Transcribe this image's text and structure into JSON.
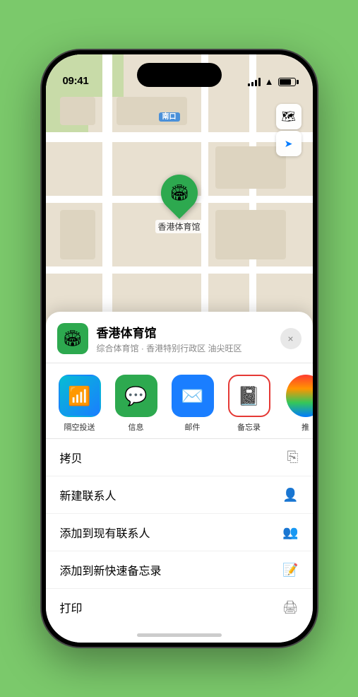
{
  "status_bar": {
    "time": "09:41",
    "location_arrow": "▶"
  },
  "map": {
    "label": "南口",
    "venue_name": "香港体育馆",
    "pin_emoji": "🏟"
  },
  "map_controls": {
    "map_btn": "🗺",
    "location_btn": "⌖"
  },
  "sheet": {
    "venue_name": "香港体育馆",
    "venue_desc": "综合体育馆 · 香港特别行政区 油尖旺区",
    "close_label": "×"
  },
  "share_items": [
    {
      "id": "airdrop",
      "label": "隔空投送",
      "emoji": "📶",
      "bg": "airdrop",
      "highlighted": false
    },
    {
      "id": "messages",
      "label": "信息",
      "emoji": "💬",
      "bg": "messages",
      "highlighted": false
    },
    {
      "id": "mail",
      "label": "邮件",
      "emoji": "✉",
      "bg": "mail",
      "highlighted": false
    },
    {
      "id": "notes",
      "label": "备忘录",
      "emoji": "📝",
      "bg": "notes",
      "highlighted": true
    }
  ],
  "action_items": [
    {
      "id": "copy",
      "label": "拷贝",
      "icon": "⎘"
    },
    {
      "id": "new-contact",
      "label": "新建联系人",
      "icon": "👤"
    },
    {
      "id": "add-existing",
      "label": "添加到现有联系人",
      "icon": "👤"
    },
    {
      "id": "add-notes",
      "label": "添加到新快速备忘录",
      "icon": "🖊"
    },
    {
      "id": "print",
      "label": "打印",
      "icon": "🖨"
    }
  ]
}
